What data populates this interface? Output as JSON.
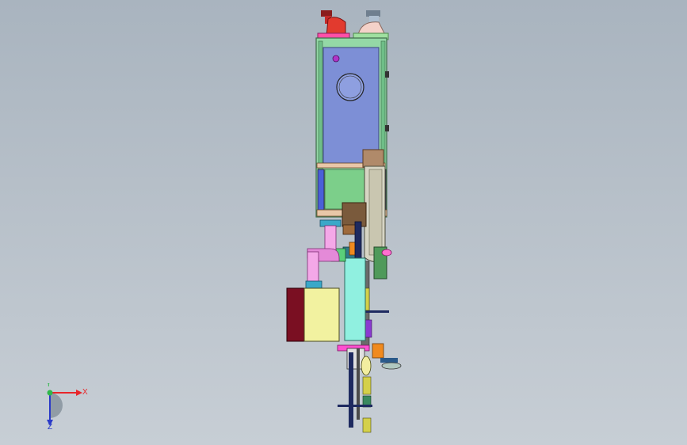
{
  "viewport": {
    "view_name": "",
    "colors": {
      "background_top": "#a9b4bf",
      "background_bottom": "#c7ced5",
      "housing_blue": "#7d8fd6",
      "frame_green": "#8fd39b",
      "pink": "#ff5fb0",
      "cream": "#f2f2a0",
      "dark_red": "#7a0f22",
      "orange": "#f08a1e"
    }
  },
  "triad": {
    "x_label": "X",
    "y_label": "Y",
    "z_label": "Z",
    "icon": "coordinate-axis-triad-icon"
  }
}
